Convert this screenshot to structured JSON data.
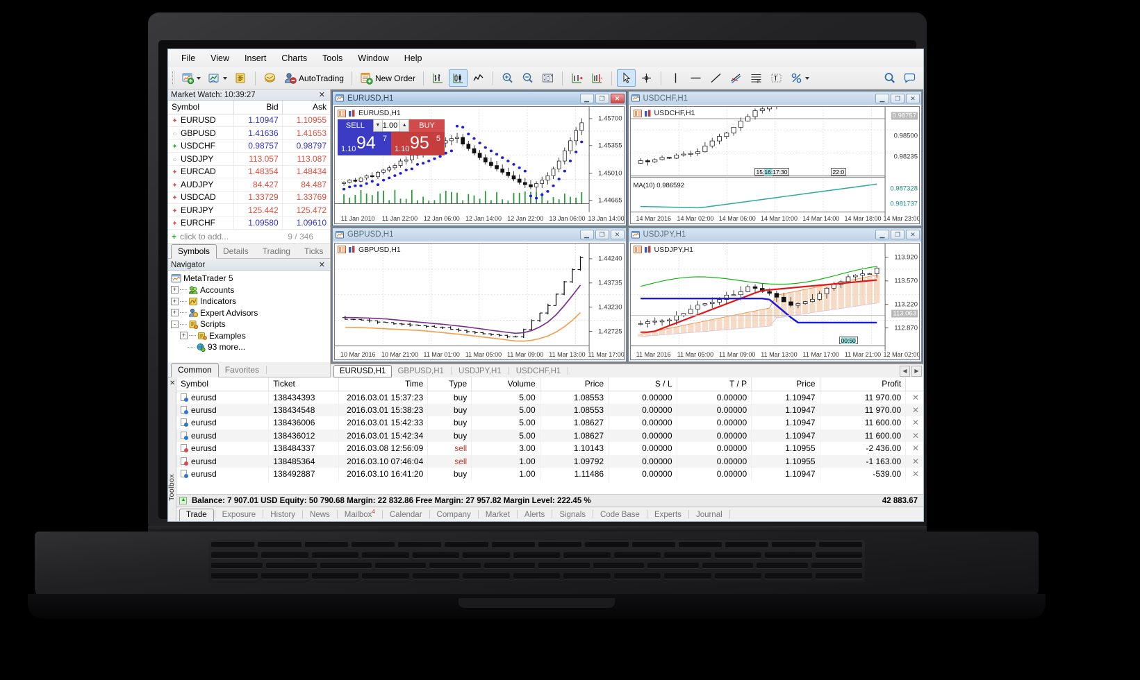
{
  "app": {
    "menu": [
      "File",
      "View",
      "Insert",
      "Charts",
      "Tools",
      "Window",
      "Help"
    ],
    "toolbar": {
      "new_chart_icon": "new-chart-icon",
      "profiles_icon": "chart-profiles-icon",
      "market_watch_icon": "market-watch-icon",
      "navigator_icon": "navigator-icon",
      "autotrading_icon": "autotrading-icon",
      "autotrading_label": "AutoTrading",
      "new_order_icon": "new-order-icon",
      "new_order_label": "New Order",
      "bar_chart_icon": "bar-chart-icon",
      "candle_chart_icon": "candlestick-chart-icon",
      "line_chart_icon": "line-chart-icon",
      "zoom_in_icon": "zoom-in-icon",
      "zoom_out_icon": "zoom-out-icon",
      "auto_scroll_icon": "auto-scroll-icon",
      "chart_shift_icon": "chart-shift-icon",
      "indicators_icon": "indicators-icon",
      "cursor_icon": "cursor-icon",
      "crosshair_icon": "crosshair-icon",
      "vline_icon": "vertical-line-icon",
      "hline_icon": "horizontal-line-icon",
      "trendline_icon": "trendline-icon",
      "fibo_icon": "fibonacci-icon",
      "equidistant_icon": "equidistant-channel-icon",
      "text_icon": "text-label-icon",
      "templates_icon": "templates-icon",
      "search_icon": "search-icon",
      "chat_icon": "chat-icon"
    }
  },
  "market_watch": {
    "title": "Market Watch: 10:39:27",
    "close_icon": "close-icon",
    "columns": [
      "Symbol",
      "Bid",
      "Ask"
    ],
    "rows": [
      {
        "dir": "down",
        "symbol": "EURUSD",
        "bid": "1.10947",
        "ask": "1.10955",
        "bid_color": "up",
        "ask_color": "dn"
      },
      {
        "dir": "none",
        "symbol": "GBPUSD",
        "bid": "1.41636",
        "ask": "1.41653",
        "bid_color": "up",
        "ask_color": "dn"
      },
      {
        "dir": "up",
        "symbol": "USDCHF",
        "bid": "0.98757",
        "ask": "0.98797",
        "bid_color": "up",
        "ask_color": "up"
      },
      {
        "dir": "none",
        "symbol": "USDJPY",
        "bid": "113.057",
        "ask": "113.087",
        "bid_color": "dn",
        "ask_color": "dn"
      },
      {
        "dir": "down",
        "symbol": "EURCAD",
        "bid": "1.48354",
        "ask": "1.48434",
        "bid_color": "dn",
        "ask_color": "dn"
      },
      {
        "dir": "down",
        "symbol": "AUDJPY",
        "bid": "84.427",
        "ask": "84.487",
        "bid_color": "dn",
        "ask_color": "dn"
      },
      {
        "dir": "down",
        "symbol": "USDCAD",
        "bid": "1.33729",
        "ask": "1.33769",
        "bid_color": "dn",
        "ask_color": "dn"
      },
      {
        "dir": "down",
        "symbol": "EURJPY",
        "bid": "125.442",
        "ask": "125.472",
        "bid_color": "dn",
        "ask_color": "dn"
      },
      {
        "dir": "down",
        "symbol": "EURCHF",
        "bid": "1.09580",
        "ask": "1.09610",
        "bid_color": "up",
        "ask_color": "up"
      }
    ],
    "add_label": "click to add...",
    "count": "9 / 346",
    "tabs": [
      "Symbols",
      "Details",
      "Trading",
      "Ticks"
    ],
    "selected_tab": "Symbols"
  },
  "navigator": {
    "title": "Navigator",
    "close_icon": "close-icon",
    "root": "MetaTrader 5",
    "items": [
      {
        "label": "Accounts",
        "icon": "accounts-icon",
        "toggle": "+",
        "depth": 1
      },
      {
        "label": "Indicators",
        "icon": "indicators-icon",
        "toggle": "+",
        "depth": 1
      },
      {
        "label": "Expert Advisors",
        "icon": "expert-advisors-icon",
        "toggle": "+",
        "depth": 1
      },
      {
        "label": "Scripts",
        "icon": "scripts-icon",
        "toggle": "-",
        "depth": 1
      },
      {
        "label": "Examples",
        "icon": "folder-icon",
        "toggle": "+",
        "depth": 2
      },
      {
        "label": "93 more...",
        "icon": "script-more-icon",
        "toggle": "",
        "depth": 2
      }
    ],
    "tabs": [
      "Common",
      "Favorites"
    ],
    "selected_tab": "Common"
  },
  "one_click_trade": {
    "sell_label": "SELL",
    "buy_label": "BUY",
    "volume": "1.00",
    "dropdown_icon": "chevron-down-icon",
    "spinner_up_icon": "chevron-up-icon",
    "sell_big": "94",
    "sell_small": "1.10",
    "sell_frac": "7",
    "buy_big": "95",
    "buy_small": "1.10",
    "buy_frac": "5"
  },
  "charts": [
    {
      "id": "eurusd",
      "title": "EURUSD,H1",
      "plot_label": "EURUSD,H1",
      "active": true,
      "minimize_icon": "minimize-icon",
      "maximize_icon": "maximize-icon",
      "close_icon": "close-icon",
      "price_ticks": [
        "1.45700",
        "1.45355",
        "1.45010",
        "1.44665"
      ],
      "time_ticks": [
        "11 Jan 2010",
        "11 Jan 22:00",
        "12 Jan 06:00",
        "12 Jan 14:00",
        "12 Jan 22:00",
        "13 Jan 06:00",
        "13 Jan 14:00"
      ],
      "has_volume": true,
      "style": "candles-with-parabolic-sar"
    },
    {
      "id": "usdchf",
      "title": "USDCHF,H1",
      "plot_label": "USDCHF,H1",
      "active": false,
      "minimize_icon": "minimize-icon",
      "maximize_icon": "maximize-icon",
      "close_icon": "close-icon",
      "price_ticks": [
        "0.98757",
        "0.98500",
        "0.98235"
      ],
      "sub_ticks": [
        "0.987328",
        "0.981737"
      ],
      "time_ticks": [
        "14 Mar 2016",
        "14 Mar 02:00",
        "14 Mar 06:00",
        "14 Mar 10:00",
        "14 Mar 14:00",
        "14 Mar 18:00",
        "14 Mar 23:00"
      ],
      "indicator_label": "MA(10) 0.986592",
      "time_bubbles": [
        "15:",
        "16:",
        "17:30",
        "22:0"
      ],
      "style": "candles-with-ma-subwindow"
    },
    {
      "id": "gbpusd",
      "title": "GBPUSD,H1",
      "plot_label": "GBPUSD,H1",
      "active": false,
      "minimize_icon": "minimize-icon",
      "maximize_icon": "maximize-icon",
      "close_icon": "close-icon",
      "price_ticks": [
        "1.44240",
        "1.43735",
        "1.43230",
        "1.42725"
      ],
      "time_ticks": [
        "10 Mar 2016",
        "10 Mar 21:00",
        "11 Mar 01:00",
        "11 Mar 05:00",
        "11 Mar 09:00",
        "11 Mar 13:00",
        "11 Mar 17:00"
      ],
      "style": "bars-with-two-ma"
    },
    {
      "id": "usdjpy",
      "title": "USDJPY,H1",
      "plot_label": "USDJPY,H1",
      "active": false,
      "minimize_icon": "minimize-icon",
      "maximize_icon": "maximize-icon",
      "close_icon": "close-icon",
      "price_ticks": [
        "113.920",
        "113.570",
        "113.220",
        "112.870"
      ],
      "highlight_tick": "113.063",
      "time_ticks": [
        "11 Mar 2016",
        "11 Mar 05:00",
        "11 Mar 09:00",
        "11 Mar 13:00",
        "11 Mar 17:00",
        "11 Mar 21:00",
        "12 Mar 02:00"
      ],
      "time_bubbles": [
        "00:50"
      ],
      "style": "candles-with-ichimoku"
    }
  ],
  "chart_tabs": {
    "tabs": [
      "EURUSD,H1",
      "GBPUSD,H1",
      "USDJPY,H1",
      "USDCHF,H1"
    ],
    "selected": "EURUSD,H1",
    "prev_icon": "chevron-left-icon",
    "next_icon": "chevron-right-icon"
  },
  "terminal": {
    "close_icon": "close-icon",
    "side_label": "Toolbox",
    "columns": [
      "Symbol",
      "Ticket",
      "Time",
      "Type",
      "Volume",
      "Price",
      "S / L",
      "T / P",
      "Price",
      "Profit"
    ],
    "rows": [
      {
        "symbol": "eurusd",
        "ticket": "138434393",
        "time": "2016.03.01 15:37:23",
        "type": "buy",
        "volume": "5.00",
        "price": "1.08553",
        "sl": "0.00000",
        "tp": "0.00000",
        "cur_price": "1.10947",
        "profit": "11 970.00",
        "dot": "#2a7ad4",
        "close_icon": "close-icon"
      },
      {
        "symbol": "eurusd",
        "ticket": "138434548",
        "time": "2016.03.01 15:38:23",
        "type": "buy",
        "volume": "5.00",
        "price": "1.08553",
        "sl": "0.00000",
        "tp": "0.00000",
        "cur_price": "1.10947",
        "profit": "11 970.00",
        "dot": "#2a7ad4",
        "close_icon": "close-icon"
      },
      {
        "symbol": "eurusd",
        "ticket": "138436006",
        "time": "2016.03.01 15:42:33",
        "type": "buy",
        "volume": "5.00",
        "price": "1.08627",
        "sl": "0.00000",
        "tp": "0.00000",
        "cur_price": "1.10947",
        "profit": "11 600.00",
        "dot": "#2a7ad4",
        "close_icon": "close-icon"
      },
      {
        "symbol": "eurusd",
        "ticket": "138436012",
        "time": "2016.03.01 15:42:34",
        "type": "buy",
        "volume": "5.00",
        "price": "1.08627",
        "sl": "0.00000",
        "tp": "0.00000",
        "cur_price": "1.10947",
        "profit": "11 600.00",
        "dot": "#2a7ad4",
        "close_icon": "close-icon"
      },
      {
        "symbol": "eurusd",
        "ticket": "138484337",
        "time": "2016.03.08 12:56:09",
        "type": "sell",
        "volume": "3.00",
        "price": "1.10143",
        "sl": "0.00000",
        "tp": "0.00000",
        "cur_price": "1.10955",
        "profit": "-2 436.00",
        "dot": "#e04a4a",
        "close_icon": "close-icon"
      },
      {
        "symbol": "eurusd",
        "ticket": "138485364",
        "time": "2016.03.10 07:46:04",
        "type": "sell",
        "volume": "1.00",
        "price": "1.09792",
        "sl": "0.00000",
        "tp": "0.00000",
        "cur_price": "1.10955",
        "profit": "-1 163.00",
        "dot": "#e04a4a",
        "close_icon": "close-icon"
      },
      {
        "symbol": "eurusd",
        "ticket": "138492887",
        "time": "2016.03.10 16:41:20",
        "type": "buy",
        "volume": "1.00",
        "price": "1.11486",
        "sl": "0.00000",
        "tp": "0.00000",
        "cur_price": "1.10947",
        "profit": "-539.00",
        "dot": "#2a7ad4",
        "close_icon": "close-icon"
      }
    ],
    "status": "Balance: 7 907.01 USD  Equity: 50 790.68  Margin: 22 832.86  Free Margin: 27 957.82  Margin Level: 222.45 %",
    "status_icon": "up-arrow-icon",
    "total_profit": "42 883.67",
    "tabs": [
      "Trade",
      "Exposure",
      "History",
      "News",
      "Mailbox",
      "Calendar",
      "Company",
      "Market",
      "Alerts",
      "Signals",
      "Code Base",
      "Experts",
      "Journal"
    ],
    "selected_tab": "Trade",
    "mailbox_badge": "4"
  },
  "chart_data": [
    {
      "type": "candlestick",
      "title": "EURUSD,H1",
      "ylim": [
        1.444,
        1.4585
      ],
      "yticks": [
        1.457,
        1.45355,
        1.4501,
        1.44665
      ],
      "xlabels": [
        "11 Jan 2010",
        "11 Jan 22:00",
        "12 Jan 06:00",
        "12 Jan 14:00",
        "12 Jan 22:00",
        "13 Jan 06:00",
        "13 Jan 14:00"
      ],
      "overlay": "Parabolic SAR",
      "ohlc": [
        [
          1.4466,
          1.447,
          1.4462,
          1.4468
        ],
        [
          1.4468,
          1.4474,
          1.4466,
          1.4472
        ],
        [
          1.4472,
          1.4476,
          1.4468,
          1.447
        ],
        [
          1.447,
          1.4478,
          1.4468,
          1.4476
        ],
        [
          1.4476,
          1.4482,
          1.4472,
          1.448
        ],
        [
          1.448,
          1.4486,
          1.4476,
          1.4478
        ],
        [
          1.4478,
          1.4488,
          1.4474,
          1.4486
        ],
        [
          1.4486,
          1.4492,
          1.4482,
          1.449
        ],
        [
          1.449,
          1.4498,
          1.4486,
          1.4494
        ],
        [
          1.4494,
          1.4502,
          1.449,
          1.4498
        ],
        [
          1.4498,
          1.451,
          1.4494,
          1.4506
        ],
        [
          1.4506,
          1.4514,
          1.45,
          1.4508
        ],
        [
          1.4508,
          1.452,
          1.4502,
          1.4516
        ],
        [
          1.4516,
          1.4524,
          1.451,
          1.4518
        ],
        [
          1.4518,
          1.453,
          1.4512,
          1.4522
        ],
        [
          1.4522,
          1.4534,
          1.4516,
          1.4528
        ],
        [
          1.4528,
          1.454,
          1.452,
          1.453
        ],
        [
          1.453,
          1.4544,
          1.4524,
          1.4538
        ],
        [
          1.4538,
          1.4548,
          1.453,
          1.4542
        ],
        [
          1.4542,
          1.4552,
          1.4534,
          1.4546
        ],
        [
          1.4546,
          1.4556,
          1.4538,
          1.4548
        ],
        [
          1.4548,
          1.4554,
          1.4532,
          1.4536
        ],
        [
          1.4536,
          1.4542,
          1.4524,
          1.4528
        ],
        [
          1.4528,
          1.4534,
          1.4516,
          1.452
        ],
        [
          1.452,
          1.4526,
          1.4508,
          1.4512
        ],
        [
          1.4512,
          1.4518,
          1.45,
          1.4504
        ],
        [
          1.4504,
          1.4512,
          1.4494,
          1.4498
        ],
        [
          1.4498,
          1.4506,
          1.4488,
          1.4492
        ],
        [
          1.4492,
          1.45,
          1.4482,
          1.4486
        ],
        [
          1.4486,
          1.4494,
          1.4476,
          1.448
        ],
        [
          1.448,
          1.4488,
          1.447,
          1.4474
        ],
        [
          1.4474,
          1.4482,
          1.4464,
          1.4468
        ],
        [
          1.4468,
          1.4476,
          1.4458,
          1.4464
        ],
        [
          1.4464,
          1.4472,
          1.4456,
          1.446
        ],
        [
          1.446,
          1.447,
          1.4452,
          1.4466
        ],
        [
          1.4466,
          1.4478,
          1.4458,
          1.4472
        ],
        [
          1.4472,
          1.4486,
          1.4464,
          1.448
        ],
        [
          1.448,
          1.4496,
          1.4474,
          1.4492
        ],
        [
          1.4492,
          1.4512,
          1.4486,
          1.4506
        ],
        [
          1.4506,
          1.453,
          1.45,
          1.4524
        ],
        [
          1.4524,
          1.4548,
          1.4518,
          1.4542
        ],
        [
          1.4542,
          1.4566,
          1.4534,
          1.456
        ],
        [
          1.456,
          1.4582,
          1.4552,
          1.4574
        ]
      ]
    },
    {
      "type": "candlestick",
      "title": "USDCHF,H1",
      "ylim": [
        0.981,
        0.988
      ],
      "yticks": [
        0.98757,
        0.985,
        0.98235
      ],
      "xlabels": [
        "14 Mar 2016",
        "14 Mar 02:00",
        "14 Mar 06:00",
        "14 Mar 10:00",
        "14 Mar 14:00",
        "14 Mar 18:00",
        "14 Mar 23:00"
      ],
      "subwindow": {
        "indicator": "MA(10)",
        "value": 0.986592,
        "color": "#2aa8a4"
      }
    },
    {
      "type": "bar",
      "title": "GBPUSD,H1",
      "ylim": [
        1.4255,
        1.444
      ],
      "yticks": [
        1.4424,
        1.43735,
        1.4323,
        1.42725
      ],
      "xlabels": [
        "10 Mar 2016",
        "10 Mar 21:00",
        "11 Mar 01:00",
        "11 Mar 05:00",
        "11 Mar 09:00",
        "11 Mar 13:00",
        "11 Mar 17:00"
      ],
      "series": [
        {
          "name": "MA fast",
          "color": "#7b2d8e"
        },
        {
          "name": "MA slow",
          "color": "#f2a04a"
        }
      ]
    },
    {
      "type": "candlestick",
      "title": "USDJPY,H1",
      "ylim": [
        112.7,
        114.05
      ],
      "yticks": [
        113.92,
        113.57,
        113.22,
        112.87
      ],
      "xlabels": [
        "11 Mar 2016",
        "11 Mar 05:00",
        "11 Mar 09:00",
        "11 Mar 13:00",
        "11 Mar 17:00",
        "11 Mar 21:00",
        "12 Mar 02:00"
      ],
      "overlay": "Ichimoku Kinko Hyo",
      "series": [
        {
          "name": "Tenkan-sen",
          "color": "#00b000"
        },
        {
          "name": "Kijun-sen",
          "color": "#e01818"
        },
        {
          "name": "Chikou Span",
          "color": "#1818e0"
        },
        {
          "name": "Senkou Span A/B cloud",
          "color": "#f0a860"
        }
      ]
    }
  ]
}
